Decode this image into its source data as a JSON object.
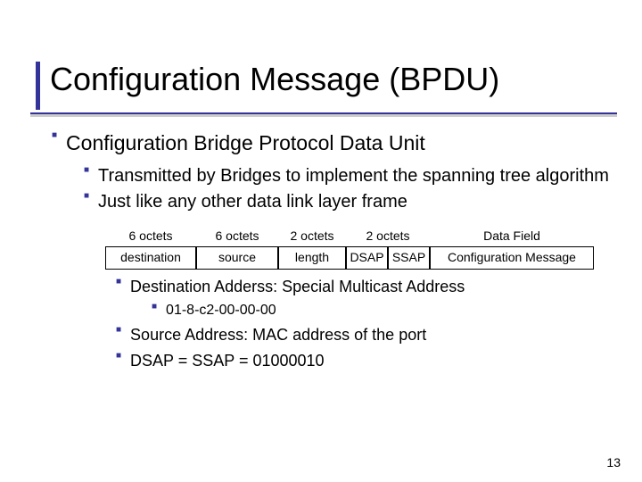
{
  "title": "Configuration Message (BPDU)",
  "level1": "Configuration Bridge Protocol Data Unit",
  "level2": {
    "a": "Transmitted by Bridges to implement the spanning tree algorithm",
    "b": "Just like any other data link layer frame"
  },
  "diagram": {
    "headers": [
      "6 octets",
      "6 octets",
      "2 octets",
      "2 octets",
      "Data Field"
    ],
    "cells": [
      "destination",
      "source",
      "length",
      "DSAP",
      "SSAP",
      "Configuration Message"
    ]
  },
  "level3": {
    "a": "Destination Adderss: Special Multicast Address",
    "b": "Source Address: MAC address of the port",
    "c": "DSAP = SSAP = 01000010"
  },
  "level4": {
    "a": "01-8-c2-00-00-00"
  },
  "page_number": "13"
}
